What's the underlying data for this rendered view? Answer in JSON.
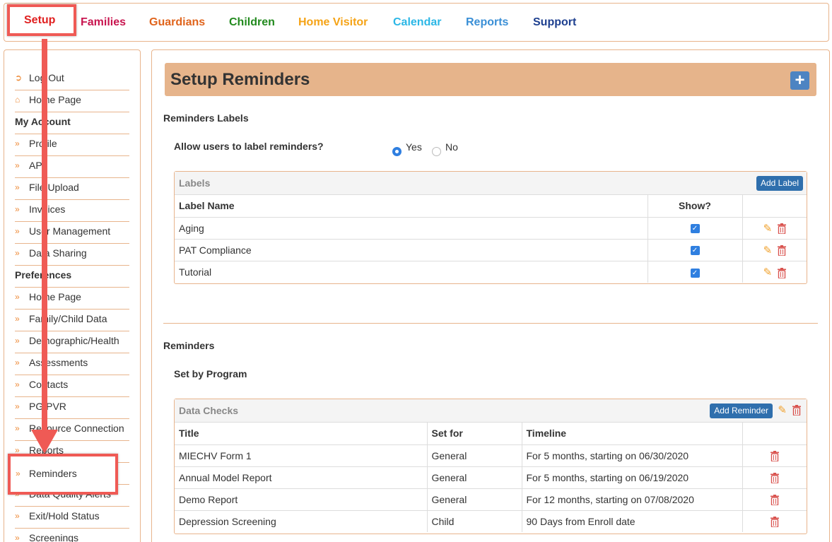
{
  "topnav": {
    "items": [
      {
        "label": "Setup",
        "color": "#e02020"
      },
      {
        "label": "Families",
        "color": "#c8154f"
      },
      {
        "label": "Guardians",
        "color": "#e0641c"
      },
      {
        "label": "Children",
        "color": "#228a1e"
      },
      {
        "label": "Home Visitor",
        "color": "#f5a316"
      },
      {
        "label": "Calendar",
        "color": "#2cb7e6"
      },
      {
        "label": "Reports",
        "color": "#3a8fd6"
      },
      {
        "label": "Support",
        "color": "#1d3f8f"
      }
    ]
  },
  "sidebar": {
    "items": [
      {
        "label": "Log Out",
        "icon": "sign-out-icon"
      },
      {
        "label": "Home Page",
        "icon": "home-icon"
      },
      {
        "label": "My Account",
        "heading": true
      },
      {
        "label": "Profile",
        "icon": "double-chevron-icon"
      },
      {
        "label": "API",
        "icon": "double-chevron-icon"
      },
      {
        "label": "File Upload",
        "icon": "double-chevron-icon"
      },
      {
        "label": "Invoices",
        "icon": "double-chevron-icon"
      },
      {
        "label": "User Management",
        "icon": "double-chevron-icon"
      },
      {
        "label": "Data Sharing",
        "icon": "double-chevron-icon"
      },
      {
        "label": "Preferences",
        "heading": true
      },
      {
        "label": "Home Page",
        "icon": "double-chevron-icon"
      },
      {
        "label": "Family/Child Data",
        "icon": "double-chevron-icon"
      },
      {
        "label": "Demographic/Health",
        "icon": "double-chevron-icon"
      },
      {
        "label": "Assessments",
        "icon": "double-chevron-icon"
      },
      {
        "label": "Contacts",
        "icon": "double-chevron-icon"
      },
      {
        "label": "PG/PVR",
        "icon": "double-chevron-icon"
      },
      {
        "label": "Resource Connection",
        "icon": "double-chevron-icon"
      },
      {
        "label": "Reports",
        "icon": "double-chevron-icon"
      },
      {
        "label": "Reminders",
        "icon": "double-chevron-icon"
      },
      {
        "label": "Data Quality Alerts",
        "icon": "double-chevron-icon"
      },
      {
        "label": "Exit/Hold Status",
        "icon": "double-chevron-icon"
      },
      {
        "label": "Screenings",
        "icon": "double-chevron-icon"
      }
    ]
  },
  "main": {
    "title": "Setup Reminders",
    "labels_section": "Reminders Labels",
    "allow_question": "Allow users to label reminders?",
    "radio_yes": "Yes",
    "radio_no": "No",
    "labels_panel": {
      "title": "Labels",
      "add_button": "Add Label",
      "col_name": "Label Name",
      "col_show": "Show?",
      "rows": [
        {
          "name": "Aging",
          "show": true
        },
        {
          "name": "PAT Compliance",
          "show": true
        },
        {
          "name": "Tutorial",
          "show": true
        }
      ]
    },
    "reminders_section": "Reminders",
    "set_by_program": "Set by Program",
    "data_checks_panel": {
      "title": "Data Checks",
      "add_button": "Add Reminder",
      "col_title": "Title",
      "col_set_for": "Set for",
      "col_timeline": "Timeline",
      "rows": [
        {
          "title": "MIECHV Form 1",
          "set_for": "General",
          "timeline": "For 5 months, starting on 06/30/2020"
        },
        {
          "title": "Annual Model Report",
          "set_for": "General",
          "timeline": "For 5 months, starting on 06/19/2020"
        },
        {
          "title": "Demo Report",
          "set_for": "General",
          "timeline": "For 12 months, starting on 07/08/2020"
        },
        {
          "title": "Depression Screening",
          "set_for": "Child",
          "timeline": "90 Days from Enroll date"
        }
      ]
    }
  }
}
